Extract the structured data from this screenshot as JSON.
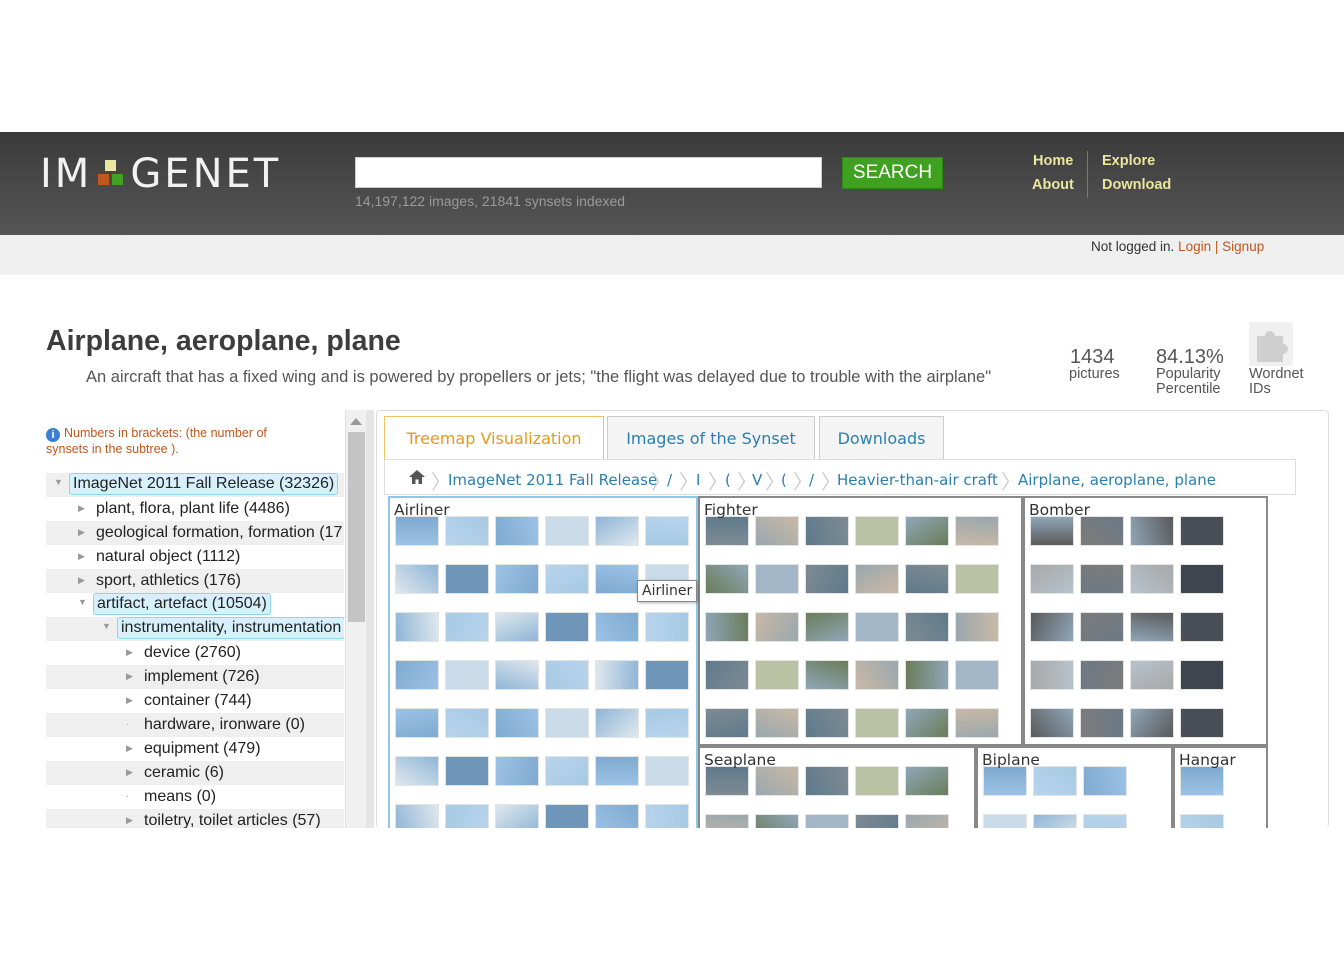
{
  "header": {
    "logo_left": "IM",
    "logo_right": "GENET",
    "search_placeholder": "",
    "search_button": "SEARCH",
    "stats": "14,197,122 images, 21841 synsets indexed",
    "nav": {
      "home": "Home",
      "about": "About",
      "explore": "Explore",
      "download": "Download"
    },
    "logo_colors": [
      "#e9e6a0",
      "#c0571c",
      "#3fa11f"
    ]
  },
  "login": {
    "status": "Not logged in.",
    "login": "Login",
    "separator": "|",
    "signup": "Signup"
  },
  "synset": {
    "title": "Airplane, aeroplane, plane",
    "gloss": "An aircraft that has a fixed wing and is powered by propellers or jets; \"the flight was delayed due to trouble with the airplane\"",
    "pictures_count": "1434",
    "pictures_label": "pictures",
    "popularity": "84.13%",
    "popularity_label_1": "Popularity",
    "popularity_label_2": "Percentile",
    "wordnet_label_1": "Wordnet",
    "wordnet_label_2": "IDs"
  },
  "tree": {
    "info_1": "Numbers in brackets: (the number of",
    "info_2": "synsets in the subtree ).",
    "items": [
      {
        "label": "ImageNet 2011 Fall Release (32326)",
        "selected": true
      },
      {
        "label": "plant, flora, plant life (4486)"
      },
      {
        "label": "geological formation, formation (17"
      },
      {
        "label": "natural object (1112)"
      },
      {
        "label": "sport, athletics (176)"
      },
      {
        "label": "artifact, artefact (10504)",
        "selected": true
      },
      {
        "label": "instrumentality, instrumentation",
        "selected": true
      },
      {
        "label": "device (2760)"
      },
      {
        "label": "implement (726)"
      },
      {
        "label": "container (744)"
      },
      {
        "label": "hardware, ironware (0)"
      },
      {
        "label": "equipment (479)"
      },
      {
        "label": "ceramic (6)"
      },
      {
        "label": "means (0)"
      },
      {
        "label": "toiletry, toilet articles (57)"
      }
    ]
  },
  "tabs": [
    {
      "label": "Treemap Visualization",
      "active": true
    },
    {
      "label": "Images of the Synset"
    },
    {
      "label": "Downloads"
    }
  ],
  "breadcrumb": {
    "items": [
      "ImageNet 2011 Fall Release",
      "/",
      "I",
      "(",
      "V",
      "(",
      "/",
      "Heavier-than-air craft",
      "Airplane, aeroplane, plane"
    ]
  },
  "treemap": {
    "cells": [
      "Airliner",
      "Fighter",
      "Bomber",
      "Seaplane",
      "Biplane",
      "Hangar"
    ],
    "tooltip": "Airliner"
  }
}
